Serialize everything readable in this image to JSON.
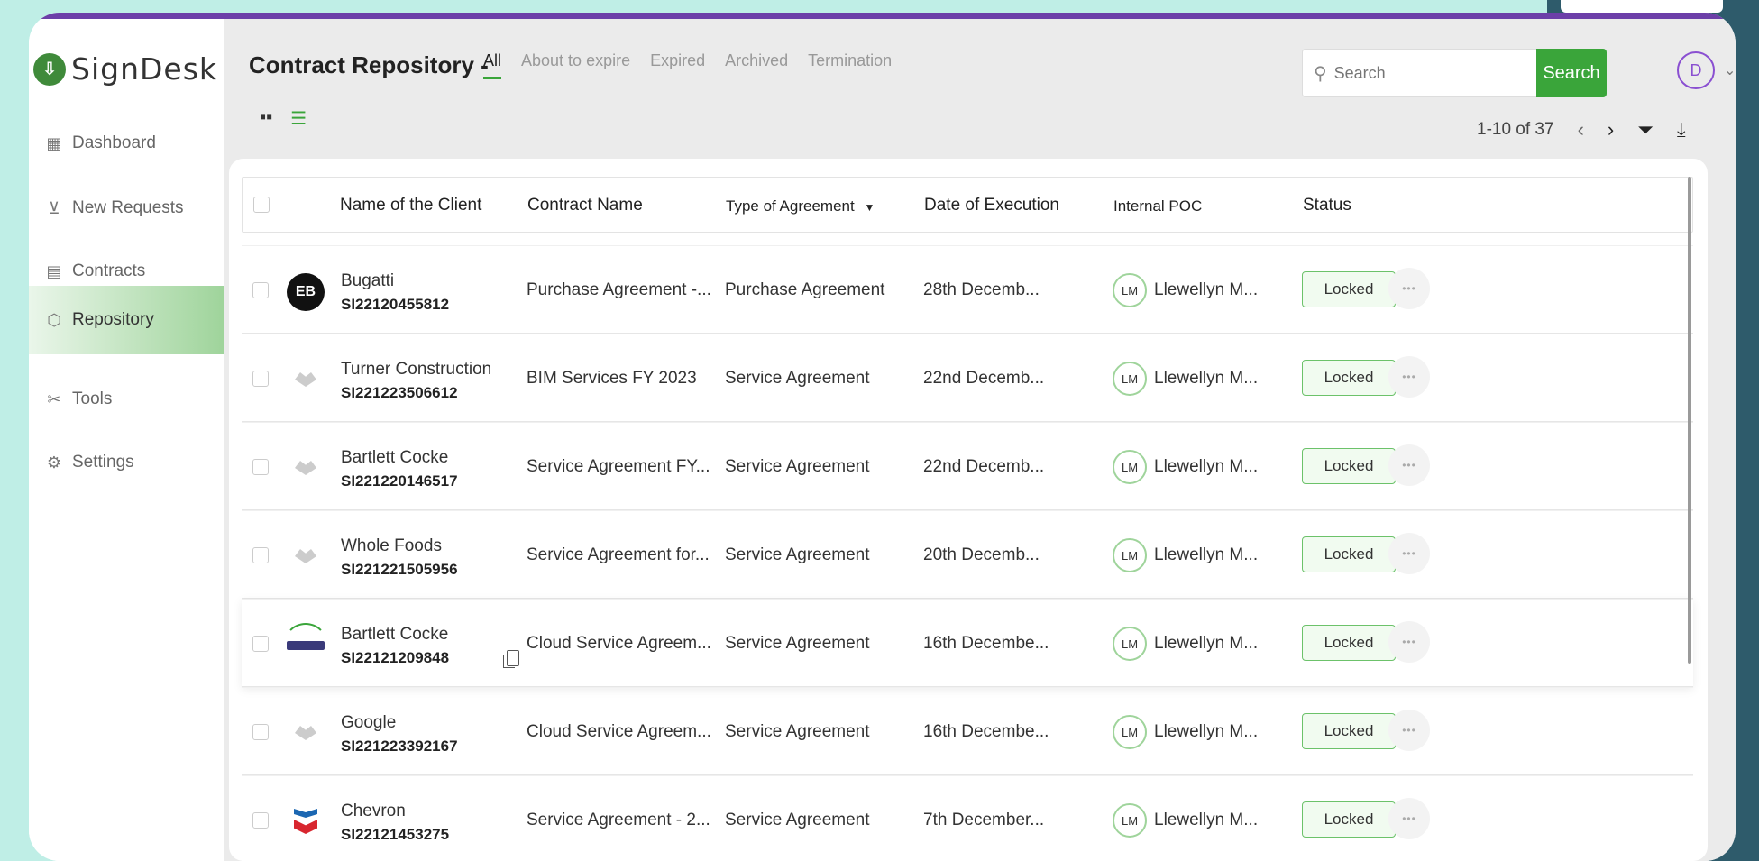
{
  "app": {
    "logo_text": "SignDesk"
  },
  "sidebar": {
    "items": [
      {
        "label": "Dashboard",
        "icon": "dashboard-icon"
      },
      {
        "label": "New Requests",
        "icon": "new-requests-icon"
      },
      {
        "label": "Contracts",
        "icon": "contracts-icon"
      },
      {
        "label": "Repository",
        "icon": "repository-icon",
        "active": true
      },
      {
        "label": "Tools",
        "icon": "tools-icon"
      },
      {
        "label": "Settings",
        "icon": "settings-icon"
      }
    ]
  },
  "header": {
    "title": "Contract Repository -",
    "tabs": [
      "All",
      "About to expire",
      "Expired",
      "Archived",
      "Termination"
    ],
    "active_tab": "All"
  },
  "search": {
    "placeholder": "Search",
    "button_label": "Search"
  },
  "user": {
    "avatar_initial": "D"
  },
  "pager": {
    "range_text": "1-10 of 37"
  },
  "table": {
    "columns": [
      "Name of the Client",
      "Contract Name",
      "Type of Agreement",
      "Date of Execution",
      "Internal POC",
      "Status"
    ],
    "rows": [
      {
        "client": "Bugatti",
        "id": "SI22120455812",
        "contract": "Purchase Agreement -...",
        "type": "Purchase Agreement",
        "date": "28th Decemb...",
        "poc_initials": "LM",
        "poc": "Llewellyn M...",
        "status": "Locked",
        "logo": "bugatti"
      },
      {
        "client": "Turner Construction",
        "id": "SI221223506612",
        "contract": "BIM Services FY 2023",
        "type": "Service Agreement",
        "date": "22nd Decemb...",
        "poc_initials": "LM",
        "poc": "Llewellyn M...",
        "status": "Locked",
        "logo": "generic"
      },
      {
        "client": "Bartlett Cocke",
        "id": "SI221220146517",
        "contract": "Service Agreement FY...",
        "type": "Service Agreement",
        "date": "22nd Decemb...",
        "poc_initials": "LM",
        "poc": "Llewellyn M...",
        "status": "Locked",
        "logo": "generic"
      },
      {
        "client": "Whole Foods",
        "id": "SI221221505956",
        "contract": "Service Agreement for...",
        "type": "Service Agreement",
        "date": "20th Decemb...",
        "poc_initials": "LM",
        "poc": "Llewellyn M...",
        "status": "Locked",
        "logo": "generic"
      },
      {
        "client": "Bartlett Cocke",
        "id": "SI22121209848",
        "contract": "Cloud Service Agreem...",
        "type": "Service Agreement",
        "date": "16th Decembe...",
        "poc_initials": "LM",
        "poc": "Llewellyn M...",
        "status": "Locked",
        "logo": "bar"
      },
      {
        "client": "Google",
        "id": "SI221223392167",
        "contract": "Cloud Service Agreem...",
        "type": "Service Agreement",
        "date": "16th Decembe...",
        "poc_initials": "LM",
        "poc": "Llewellyn M...",
        "status": "Locked",
        "logo": "generic"
      },
      {
        "client": "Chevron",
        "id": "SI22121453275",
        "contract": "Service Agreement - 2...",
        "type": "Service Agreement",
        "date": "7th December...",
        "poc_initials": "LM",
        "poc": "Llewellyn M...",
        "status": "Locked",
        "logo": "chevron"
      }
    ]
  },
  "colors": {
    "accent": "#3aa53a",
    "topbar": "#6c3fa8",
    "avatar_ring": "#8a4fd1"
  }
}
